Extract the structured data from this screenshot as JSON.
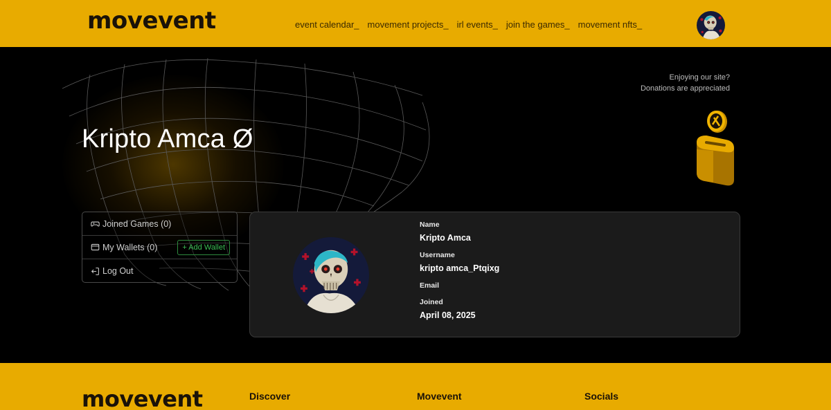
{
  "header": {
    "logo_text": "movevent",
    "nav": [
      "event calendar_",
      "movement projects_",
      "irl events_",
      "join the games_",
      "movement nfts_"
    ]
  },
  "profile": {
    "title": "Kripto Amca Ø",
    "name_label": "Name",
    "name_value": "Kripto Amca",
    "username_label": "Username",
    "username_value": "kripto amca_Ptqixg",
    "email_label": "Email",
    "email_value": "",
    "joined_label": "Joined",
    "joined_value": "April 08, 2025"
  },
  "donation": {
    "line1": "Enjoying our site?",
    "line2": "Donations are appreciated"
  },
  "menu": {
    "joined_games": "Joined Games (0)",
    "my_wallets": "My Wallets (0)",
    "add_wallet": "+ Add Wallet",
    "log_out": "Log Out"
  },
  "footer": {
    "logo_text": "movevent",
    "col1": "Discover",
    "col2": "Movevent",
    "col3": "Socials"
  },
  "colors": {
    "brand_yellow": "#e8ab00",
    "add_wallet_green": "#3bbf55"
  }
}
